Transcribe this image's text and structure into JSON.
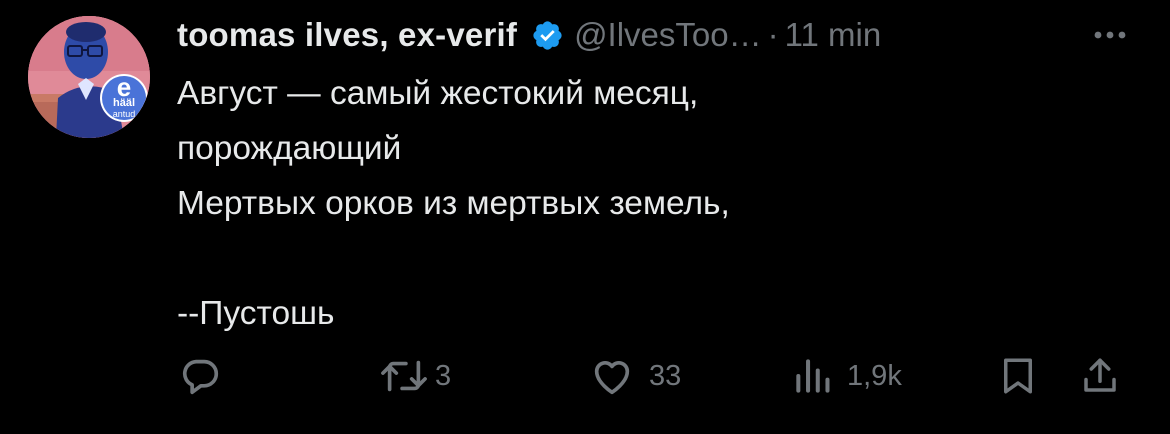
{
  "author": {
    "name": "toomas ilves, ex-verif",
    "handle": "@IlvesToo…",
    "separator": "·",
    "time": "11 min",
    "avatar_badge": {
      "letter": "e",
      "line1": "hääl",
      "line2": "antud"
    }
  },
  "tweet": {
    "lines": [
      "Август — самый жестокий месяц,",
      "порождающий",
      "Мертвых орков из мертвых земель,",
      "",
      "--Пустошь"
    ]
  },
  "actions": {
    "reply": {
      "icon": "reply-icon",
      "count": ""
    },
    "retweet": {
      "icon": "retweet-icon",
      "count": "3"
    },
    "like": {
      "icon": "heart-icon",
      "count": "33"
    },
    "views": {
      "icon": "views-icon",
      "count": "1,9k"
    },
    "bookmark": {
      "icon": "bookmark-icon"
    },
    "share": {
      "icon": "share-icon"
    }
  },
  "colors": {
    "background": "#000000",
    "text": "#e7e9ea",
    "muted": "#71767b",
    "verified": "#1d9bf0",
    "avatar_bg": "#e08a98"
  }
}
